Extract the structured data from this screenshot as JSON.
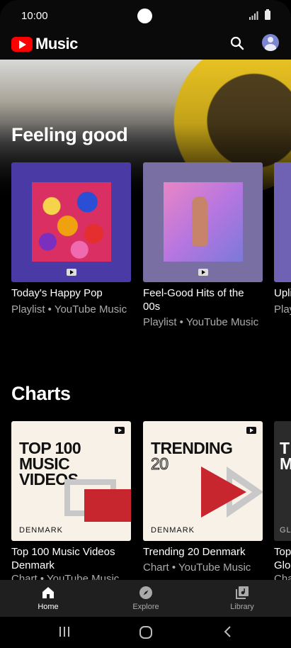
{
  "status": {
    "time": "10:00"
  },
  "app": {
    "logo_text": "Music"
  },
  "sections": [
    {
      "title": "Feeling good",
      "items": [
        {
          "title": "Today's Happy Pop",
          "subtitle": "Playlist • YouTube Music"
        },
        {
          "title": "Feel-Good Hits of the 00s",
          "subtitle": "Playlist • YouTube Music"
        },
        {
          "title": "Upli",
          "subtitle": "Play"
        }
      ]
    },
    {
      "title": "Charts",
      "items": [
        {
          "art_line1": "TOP 100",
          "art_line2": "MUSIC VIDEOS",
          "art_country": "DENMARK",
          "title": "Top 100 Music Videos Denmark",
          "subtitle": "Chart • YouTube Music"
        },
        {
          "art_line1": "TRENDING",
          "art_line2": "20",
          "art_country": "DENMARK",
          "title": "Trending 20 Denmark",
          "subtitle": "Chart • YouTube Music"
        },
        {
          "art_line1": "T",
          "art_line2": "M",
          "art_country": "GL",
          "title": "Top",
          "subtitle2": "Glo",
          "subtitle": "Cha"
        }
      ]
    }
  ],
  "bottom_nav": [
    {
      "label": "Home",
      "icon": "home-icon",
      "active": true
    },
    {
      "label": "Explore",
      "icon": "compass-icon",
      "active": false
    },
    {
      "label": "Library",
      "icon": "library-icon",
      "active": false
    }
  ],
  "colors": {
    "brand": "#FF0000",
    "chart_red": "#C7262F",
    "card_cream": "#F7F1E8"
  }
}
